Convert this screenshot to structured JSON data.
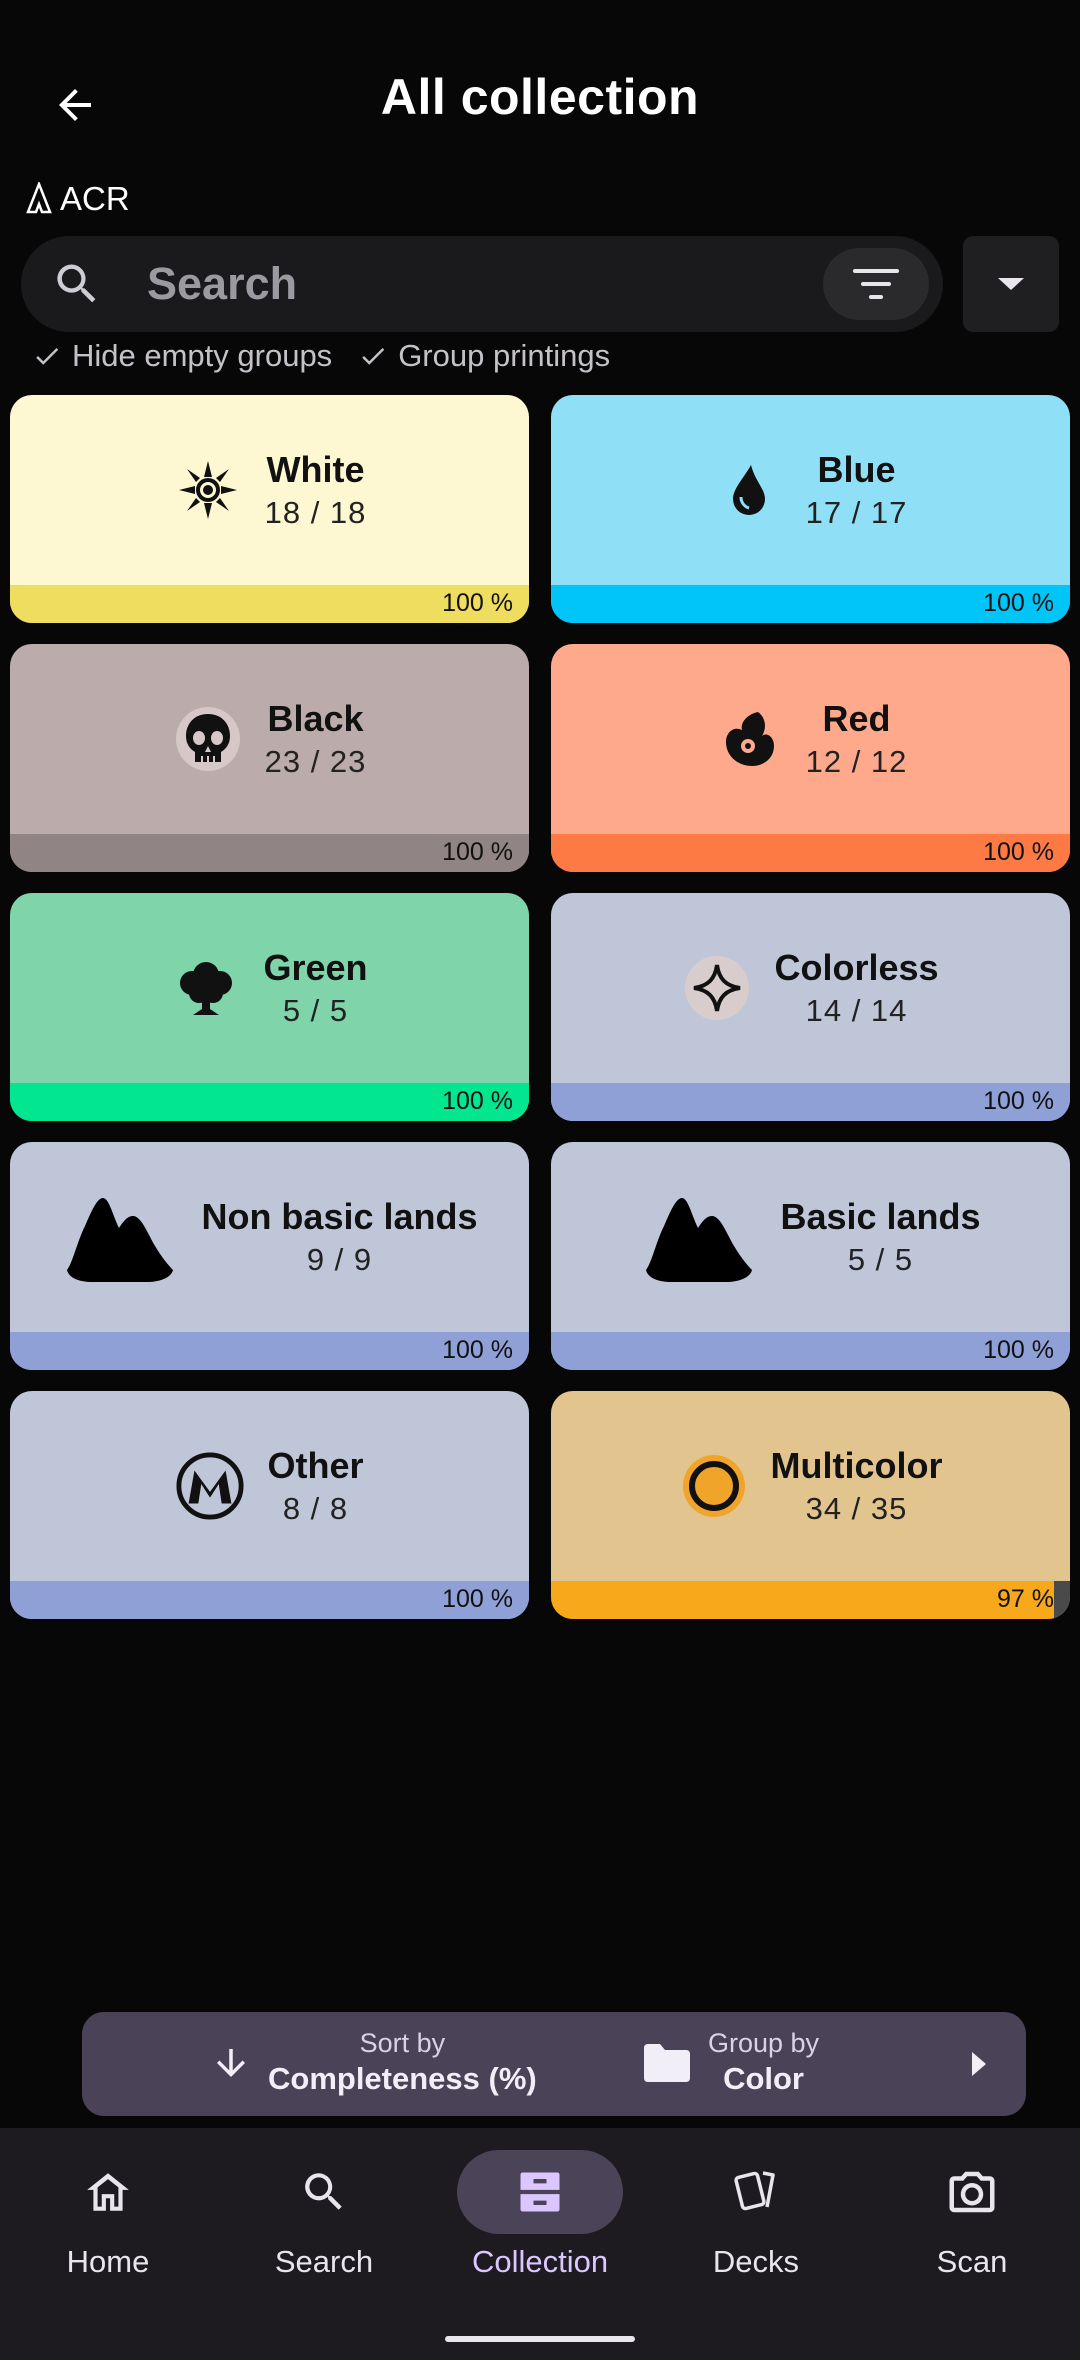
{
  "header": {
    "title": "All collection"
  },
  "set": {
    "code": "ACR"
  },
  "search": {
    "placeholder": "Search",
    "value": ""
  },
  "options": {
    "hide_empty": "Hide empty groups",
    "group_printings": "Group printings"
  },
  "groups": [
    {
      "name": "White",
      "count": "18 / 18",
      "percent": "100 %",
      "progress": 1.0,
      "bg": "#fdf7d2",
      "bar": "#eedd5e",
      "bar_bg": "#eedd5e"
    },
    {
      "name": "Blue",
      "count": "17 / 17",
      "percent": "100 %",
      "progress": 1.0,
      "bg": "#8fdff7",
      "bar": "#00c5f6",
      "bar_bg": "#00c5f6"
    },
    {
      "name": "Black",
      "count": "23 / 23",
      "percent": "100 %",
      "progress": 1.0,
      "bg": "#bcabab",
      "bar": "#918484",
      "bar_bg": "#918484"
    },
    {
      "name": "Red",
      "count": "12 / 12",
      "percent": "100 %",
      "progress": 1.0,
      "bg": "#fea98b",
      "bar": "#fe7a45",
      "bar_bg": "#fe7a45"
    },
    {
      "name": "Green",
      "count": "5 / 5",
      "percent": "100 %",
      "progress": 1.0,
      "bg": "#7fd5a9",
      "bar": "#02e690",
      "bar_bg": "#02e690"
    },
    {
      "name": "Colorless",
      "count": "14 / 14",
      "percent": "100 %",
      "progress": 1.0,
      "bg": "#bec6d8",
      "bar": "#8fa0d7",
      "bar_bg": "#8fa0d7"
    },
    {
      "name": "Non basic lands",
      "count": "9 / 9",
      "percent": "100 %",
      "progress": 1.0,
      "bg": "#bec6d8",
      "bar": "#8fa0d7",
      "bar_bg": "#8fa0d7"
    },
    {
      "name": "Basic lands",
      "count": "5 / 5",
      "percent": "100 %",
      "progress": 1.0,
      "bg": "#bec6d8",
      "bar": "#8fa0d7",
      "bar_bg": "#8fa0d7"
    },
    {
      "name": "Other",
      "count": "8 / 8",
      "percent": "100 %",
      "progress": 1.0,
      "bg": "#bec6d8",
      "bar": "#8fa0d7",
      "bar_bg": "#8fa0d7"
    },
    {
      "name": "Multicolor",
      "count": "34 / 35",
      "percent": "97 %",
      "progress": 0.97,
      "bg": "#e2c48e",
      "bar": "#f8a91b",
      "bar_bg": "#4a4a4a"
    }
  ],
  "icons": [
    "white-mana-icon",
    "blue-mana-icon",
    "black-mana-icon",
    "red-mana-icon",
    "green-mana-icon",
    "colorless-mana-icon",
    "non-basic-land-icon",
    "basic-land-icon",
    "other-icon",
    "multicolor-icon"
  ],
  "sortbar": {
    "sort_label": "Sort by",
    "sort_value": "Completeness (%)",
    "group_label": "Group by",
    "group_value": "Color"
  },
  "nav": {
    "items": [
      {
        "label": "Home"
      },
      {
        "label": "Search"
      },
      {
        "label": "Collection"
      },
      {
        "label": "Decks"
      },
      {
        "label": "Scan"
      }
    ],
    "active": "Collection"
  }
}
